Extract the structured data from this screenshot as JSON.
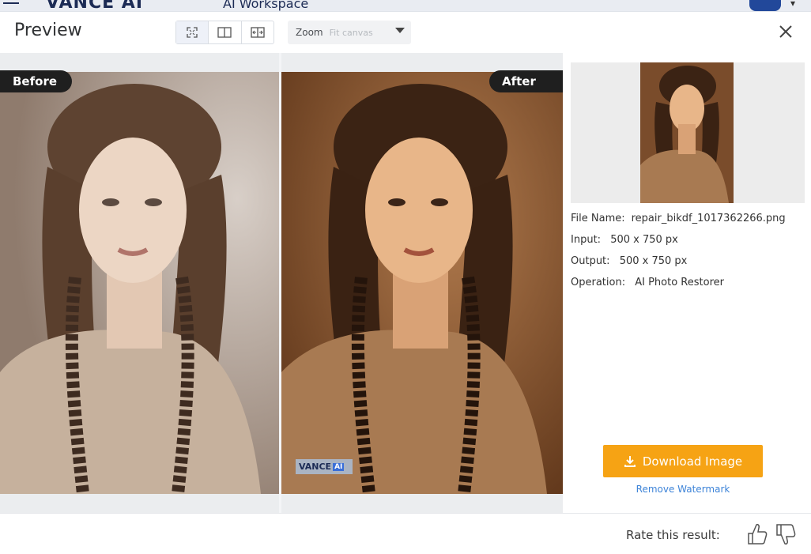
{
  "background_app": {
    "logo_text": "VANCE AI",
    "workspace_title": "AI Workspace"
  },
  "modal": {
    "title": "Preview",
    "view_modes": [
      {
        "icon": "fit-screen-icon",
        "active": true
      },
      {
        "icon": "split-view-icon",
        "active": false
      },
      {
        "icon": "side-by-side-icon",
        "active": false
      }
    ],
    "zoom": {
      "label": "Zoom",
      "value": "Fit canvas"
    },
    "close_icon": "close-icon"
  },
  "compare": {
    "before_label": "Before",
    "after_label": "After",
    "watermark_text": "VANCE",
    "watermark_ai": "AI"
  },
  "info": {
    "file_name_label": "File Name:",
    "file_name_value": "repair_bikdf_1017362266.png",
    "input_label": "Input:",
    "input_value": "500 x 750 px",
    "output_label": "Output:",
    "output_value": "500 x 750 px",
    "operation_label": "Operation:",
    "operation_value": "AI Photo Restorer"
  },
  "actions": {
    "download_label": "Download Image",
    "download_icon": "download-icon",
    "remove_watermark_label": "Remove Watermark"
  },
  "footer": {
    "rate_label": "Rate this result:",
    "thumbs_up_icon": "thumbs-up-icon",
    "thumbs_down_icon": "thumbs-down-icon"
  },
  "colors": {
    "accent_orange": "#f6a314",
    "link_blue": "#3e84d8",
    "tag_dark": "#1f1f1f"
  }
}
